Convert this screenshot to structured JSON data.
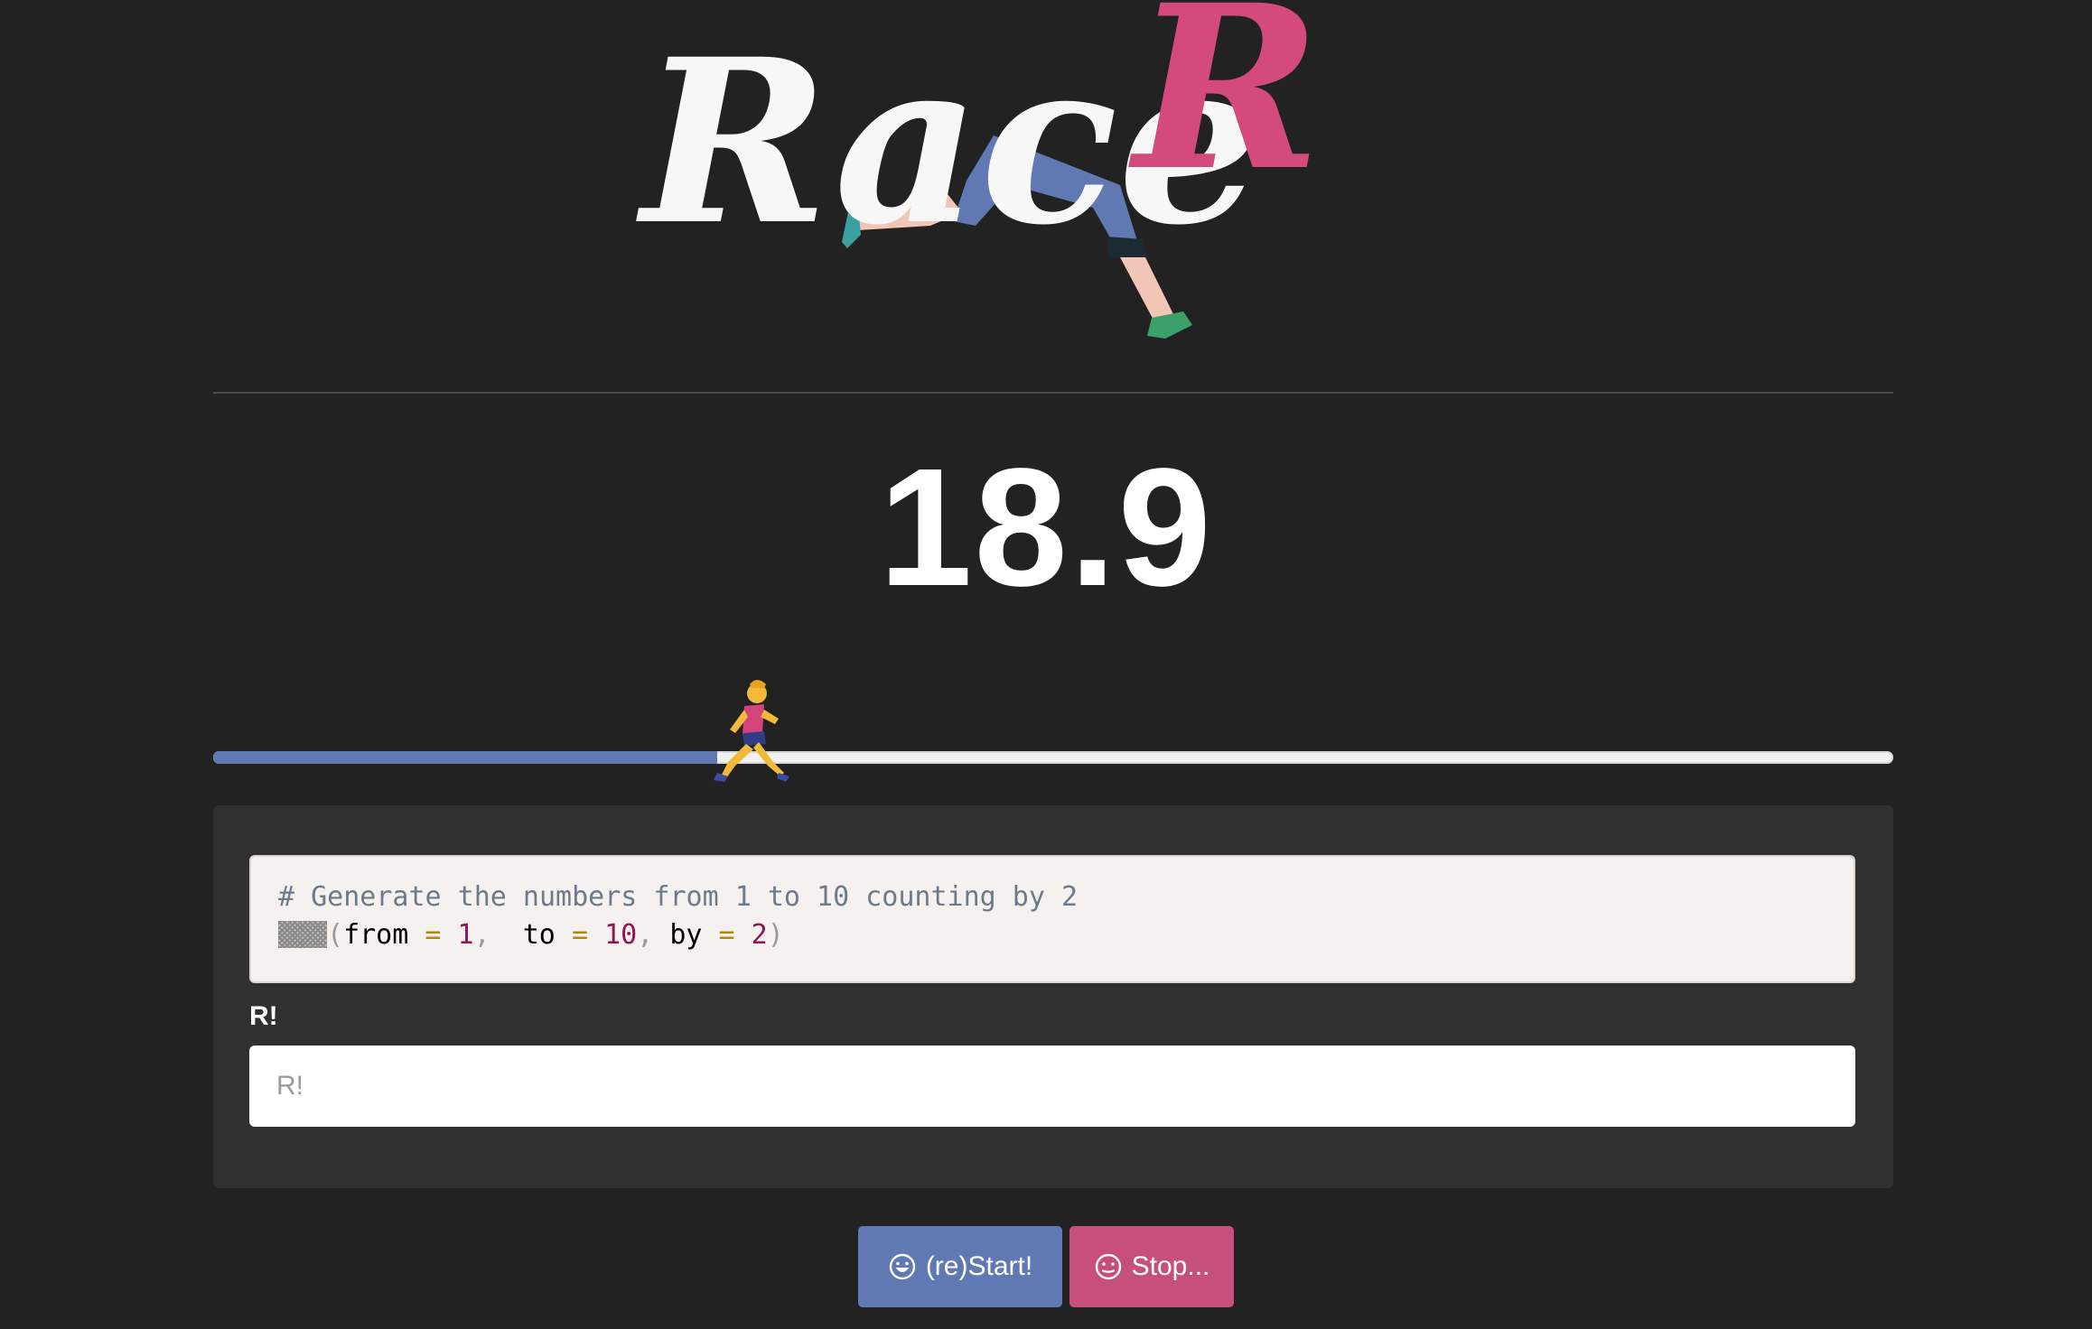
{
  "logo": {
    "text_main": "Race",
    "text_accent": "R",
    "colors": {
      "main": "#f7f7f7",
      "accent": "#d44a7c",
      "legs": "#6179b2"
    }
  },
  "timer": {
    "value": "18.9"
  },
  "progress": {
    "fraction": 0.3,
    "fill_color": "#6179b2",
    "runner_icon": "runner-icon"
  },
  "challenge": {
    "comment": "# Generate the numbers from 1 to 10 counting by 2",
    "code_open": "(",
    "arg1_name": "from",
    "arg1_op": "=",
    "arg1_value": "1",
    "sep1": ",",
    "arg2_name": "to",
    "arg2_op": "=",
    "arg2_value": "10",
    "sep2": ",",
    "arg3_name": "by",
    "arg3_op": "=",
    "arg3_value": "2",
    "code_close": ")"
  },
  "answer": {
    "label": "R!",
    "placeholder": "R!",
    "value": ""
  },
  "buttons": {
    "start_label": "(re)Start!",
    "start_icon": "grin-icon",
    "stop_label": "Stop...",
    "stop_icon": "neutral-face-icon"
  },
  "colors": {
    "background": "#222222",
    "card": "#303030",
    "start": "#6179b2",
    "stop": "#c64f7c"
  }
}
